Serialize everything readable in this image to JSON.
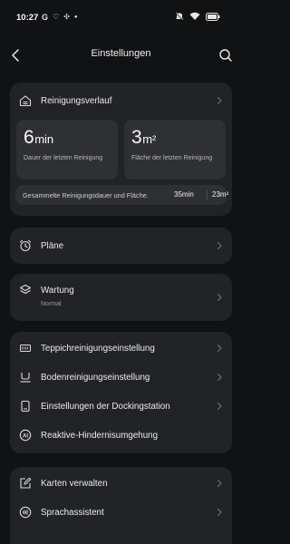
{
  "status": {
    "time": "10:27",
    "left_icons": [
      "google-g-icon",
      "heart-rate-icon",
      "grid-app-icon",
      "dot"
    ],
    "right_icons": [
      "mute-icon",
      "wifi-icon",
      "battery-icon"
    ]
  },
  "header": {
    "title": "Einstellungen"
  },
  "cleaning_history": {
    "label": "Reinigungsverlauf",
    "last_duration": {
      "value": "6",
      "unit": "min",
      "caption": "Dauer der letzten Reinigung"
    },
    "last_area": {
      "value": "3",
      "unit": "m²",
      "caption": "Fläche der letzten Reinigung"
    },
    "total": {
      "label": "Gesammelte Reinigungsdauer und Fläche.",
      "time": "35min",
      "area": "23m²"
    }
  },
  "schedules": {
    "label": "Pläne"
  },
  "maintenance": {
    "label": "Wartung",
    "status": "Normal"
  },
  "settings_group": [
    {
      "label": "Teppichreinigungseinstellung",
      "icon": "carpet-icon"
    },
    {
      "label": "Bodenreinigungseinstellung",
      "icon": "floor-icon"
    },
    {
      "label": "Einstellungen der Dockingstation",
      "icon": "dock-icon"
    },
    {
      "label": "Reaktive-Hindernisumgehung",
      "icon": "ai-icon"
    }
  ],
  "map_group": [
    {
      "label": "Karten verwalten",
      "icon": "map-edit-icon"
    },
    {
      "label": "Sprachassistent",
      "icon": "voice-icon"
    }
  ]
}
